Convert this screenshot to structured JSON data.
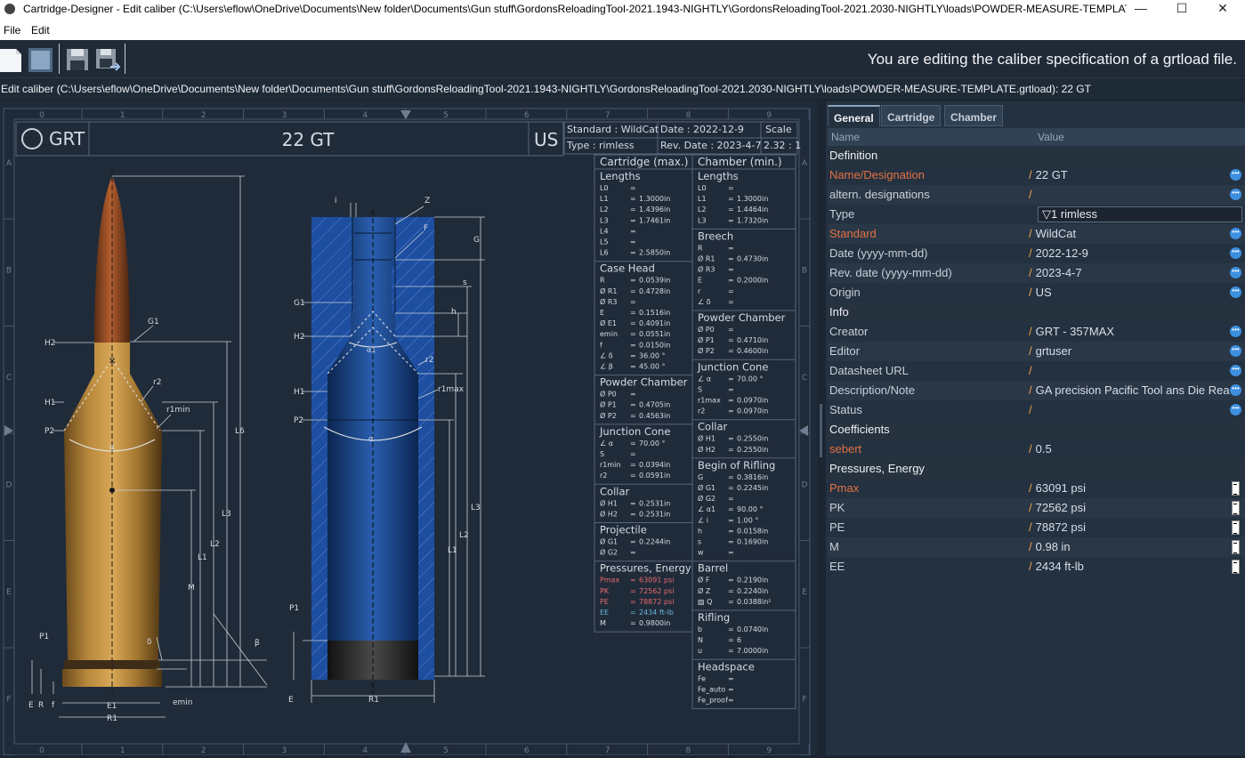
{
  "window": {
    "title": "Cartridge-Designer - Edit caliber (C:\\Users\\eflow\\OneDrive\\Documents\\New folder\\Documents\\Gun stuff\\GordonsReloadingTool-2021.1943-NIGHTLY\\GordonsReloadingTool-2021.2030-NIGHTLY\\loads\\POWDER-MEASURE-TEMPLAT...",
    "minimize": "—",
    "maximize": "☐",
    "close": "✕"
  },
  "menu": {
    "file": "File",
    "edit": "Edit"
  },
  "toolbar": {
    "note": "You are editing the caliber specification of a grtload file."
  },
  "pathbar": "Edit caliber (C:\\Users\\eflow\\OneDrive\\Documents\\New folder\\Documents\\Gun stuff\\GordonsReloadingTool-2021.1943-NIGHTLY\\GordonsReloadingTool-2021.2030-NIGHTLY\\loads\\POWDER-MEASURE-TEMPLATE.grtload): 22 GT",
  "drawing": {
    "ruler_top": [
      "0",
      "1",
      "2",
      "3",
      "4",
      "5",
      "6",
      "7",
      "8",
      "9"
    ],
    "ruler_side": [
      "A",
      "B",
      "C",
      "D",
      "E",
      "F"
    ],
    "logo": "GRT",
    "caliber": "22 GT",
    "origin": "US",
    "standard": "Standard : WildCat",
    "type": "Type        : rimless",
    "date": "Date         : 2022-12-9",
    "revdate": "Rev. Date : 2023-4-7",
    "scale_label": "Scale",
    "scale": "2.32 : 1",
    "case_labels": {
      "G1": "G1",
      "H2": "H2",
      "H1": "H1",
      "P2": "P2",
      "r2": "r2",
      "r1min": "r1min",
      "alpha": "α",
      "L6": "L6",
      "L3": "L3",
      "L2": "L2",
      "L1": "L1",
      "M": "M",
      "P1": "P1",
      "delta": "δ",
      "beta": "β",
      "E": "E",
      "R": "R",
      "f": "f",
      "E1": "E1",
      "R1": "R1",
      "emin": "emin"
    },
    "chamber_labels": {
      "i": "i",
      "Z": "Z",
      "F": "F",
      "G": "G",
      "G1": "G1",
      "s": "s",
      "h": "h",
      "H2": "H2",
      "alpha1": "α1",
      "r2": "r2",
      "H1": "H1",
      "r1max": "r1max",
      "P2": "P2",
      "alpha": "α",
      "L3": "L3",
      "L2": "L2",
      "L1": "L1",
      "P1": "P1",
      "E": "E",
      "R1": "R1"
    },
    "cartridge_table": {
      "header": "Cartridge (max.)",
      "sections": [
        {
          "title": "Lengths",
          "rows": [
            [
              "L0",
              "=",
              ""
            ],
            [
              "L1",
              "=",
              "1.3000in"
            ],
            [
              "L2",
              "=",
              "1.4396in"
            ],
            [
              "L3",
              "=",
              "1.7461in"
            ],
            [
              "L4",
              "=",
              ""
            ],
            [
              "L5",
              "=",
              ""
            ],
            [
              "L6",
              "=",
              "2.5850in"
            ]
          ]
        },
        {
          "title": "Case Head",
          "rows": [
            [
              "R",
              "=",
              "0.0539in"
            ],
            [
              "Ø R1",
              "=",
              "0.4728in"
            ],
            [
              "Ø R3",
              "=",
              ""
            ],
            [
              "E",
              "=",
              "0.1516in"
            ],
            [
              "Ø E1",
              "=",
              "0.4091in"
            ],
            [
              "emin",
              "=",
              "0.0551in"
            ],
            [
              "f",
              "=",
              "0.0150in"
            ],
            [
              "∠ δ",
              "=",
              "36.00 °"
            ],
            [
              "∠ β",
              "=",
              "45.00 °"
            ]
          ]
        },
        {
          "title": "Powder Chamber",
          "rows": [
            [
              "Ø P0",
              "=",
              ""
            ],
            [
              "Ø P1",
              "=",
              "0.4705in"
            ],
            [
              "Ø P2",
              "=",
              "0.4563in"
            ]
          ]
        },
        {
          "title": "Junction Cone",
          "rows": [
            [
              "∠ α",
              "=",
              "70.00 °"
            ],
            [
              "S",
              "=",
              ""
            ],
            [
              "r1min",
              "=",
              "0.0394in"
            ],
            [
              "r2",
              "=",
              "0.0591in"
            ]
          ]
        },
        {
          "title": "Collar",
          "rows": [
            [
              "Ø H1",
              "=",
              "0.2531in"
            ],
            [
              "Ø H2",
              "=",
              "0.2531in"
            ]
          ]
        },
        {
          "title": "Projectile",
          "rows": [
            [
              "Ø G1",
              "=",
              "0.2244in"
            ],
            [
              "Ø G2",
              "=",
              ""
            ]
          ]
        },
        {
          "title": "Pressures, Energy",
          "rows": [
            [
              "Pmax",
              "=",
              "63091 psi"
            ],
            [
              "PK",
              "=",
              "72562 psi"
            ],
            [
              "PE",
              "=",
              "78872 psi"
            ],
            [
              "EE",
              "=",
              "2434   ft-lb"
            ],
            [
              "M",
              "=",
              "0.9800in"
            ]
          ]
        }
      ]
    },
    "chamber_table": {
      "header": "Chamber (min.)",
      "sections": [
        {
          "title": "Lengths",
          "rows": [
            [
              "L0",
              "=",
              ""
            ],
            [
              "L1",
              "=",
              "1.3000in"
            ],
            [
              "L2",
              "=",
              "1.4464in"
            ],
            [
              "L3",
              "=",
              "1.7320in"
            ]
          ]
        },
        {
          "title": "Breech",
          "rows": [
            [
              "R",
              "=",
              ""
            ],
            [
              "Ø R1",
              "=",
              "0.4730in"
            ],
            [
              "Ø R3",
              "=",
              ""
            ],
            [
              "E",
              "=",
              "0.2000in"
            ],
            [
              "r",
              "=",
              ""
            ],
            [
              "∠ δ",
              "=",
              ""
            ]
          ]
        },
        {
          "title": "Powder Chamber",
          "rows": [
            [
              "Ø P0",
              "=",
              ""
            ],
            [
              "Ø P1",
              "=",
              "0.4710in"
            ],
            [
              "Ø P2",
              "=",
              "0.4600in"
            ]
          ]
        },
        {
          "title": "Junction Cone",
          "rows": [
            [
              "∠ α",
              "=",
              "70.00 °"
            ],
            [
              "S",
              "=",
              ""
            ],
            [
              "r1max",
              "=",
              "0.0970in"
            ],
            [
              "r2",
              "=",
              "0.0970in"
            ]
          ]
        },
        {
          "title": "Collar",
          "rows": [
            [
              "Ø H1",
              "=",
              "0.2550in"
            ],
            [
              "Ø H2",
              "=",
              "0.2550in"
            ]
          ]
        },
        {
          "title": "Begin of Rifling",
          "rows": [
            [
              "G",
              "=",
              "0.3816in"
            ],
            [
              "Ø G1",
              "=",
              "0.2245in"
            ],
            [
              "Ø G2",
              "=",
              ""
            ],
            [
              "∠ α1",
              "=",
              "90.00 °"
            ],
            [
              "∠ i",
              "=",
              "1.00 °"
            ],
            [
              "h",
              "=",
              "0.0158in"
            ],
            [
              "s",
              "=",
              "0.1690in"
            ],
            [
              "w",
              "=",
              ""
            ]
          ]
        },
        {
          "title": "Barrel",
          "rows": [
            [
              "Ø F",
              "=",
              "0.2190in"
            ],
            [
              "Ø Z",
              "=",
              "0.2240in"
            ],
            [
              "▨ Q",
              "=",
              "0.0388in²"
            ]
          ]
        },
        {
          "title": "Rifling",
          "rows": [
            [
              "b",
              "=",
              "0.0740in"
            ],
            [
              "N",
              "=",
              "6"
            ],
            [
              "u",
              "=",
              "7.0000in"
            ]
          ]
        },
        {
          "title": "Headspace",
          "rows": [
            [
              "Fe",
              "=",
              ""
            ],
            [
              "Fe_auto",
              "=",
              ""
            ],
            [
              "Fe_proof",
              "=",
              ""
            ]
          ]
        }
      ]
    }
  },
  "tabs": [
    "General",
    "Cartridge",
    "Chamber"
  ],
  "grid_header": {
    "name": "Name",
    "value": "Value"
  },
  "properties": [
    {
      "kind": "section",
      "name": "Definition"
    },
    {
      "name": "Name/Designation",
      "value": "22 GT",
      "red": true,
      "btn": "dots"
    },
    {
      "name": "altern. designations",
      "value": "",
      "btn": "dots"
    },
    {
      "name": "Type",
      "value": "1 rimless",
      "combo": true
    },
    {
      "name": "Standard",
      "value": "WildCat",
      "red": true,
      "btn": "dots"
    },
    {
      "name": "Date (yyyy-mm-dd)",
      "value": "2022-12-9",
      "btn": "dots"
    },
    {
      "name": "Rev. date (yyyy-mm-dd)",
      "value": "2023-4-7",
      "btn": "dots"
    },
    {
      "name": "Origin",
      "value": "US",
      "btn": "dots"
    },
    {
      "kind": "section",
      "name": "Info"
    },
    {
      "name": "Creator",
      "value": "GRT - 357MAX",
      "btn": "dots"
    },
    {
      "name": "Editor",
      "value": "grtuser",
      "btn": "dots"
    },
    {
      "name": "Datasheet URL",
      "value": "",
      "btn": "dots"
    },
    {
      "name": "Description/Note",
      "value": "GA precision Pacific Tool ans Die Reamer",
      "btn": "dots"
    },
    {
      "name": "Status",
      "value": "",
      "btn": "dots"
    },
    {
      "kind": "section",
      "name": "Coefficients"
    },
    {
      "name": "sebert",
      "value": "0.5",
      "red": true
    },
    {
      "kind": "section",
      "name": "Pressures, Energy"
    },
    {
      "name": "Pmax",
      "value": "63091 psi",
      "red": true,
      "btn": "ruler"
    },
    {
      "name": "PK",
      "value": "72562 psi",
      "btn": "ruler"
    },
    {
      "name": "PE",
      "value": "78872 psi",
      "btn": "ruler"
    },
    {
      "name": "M",
      "value": "0.98 in",
      "btn": "ruler"
    },
    {
      "name": "EE",
      "value": "2434 ft-lb",
      "btn": "ruler"
    }
  ]
}
